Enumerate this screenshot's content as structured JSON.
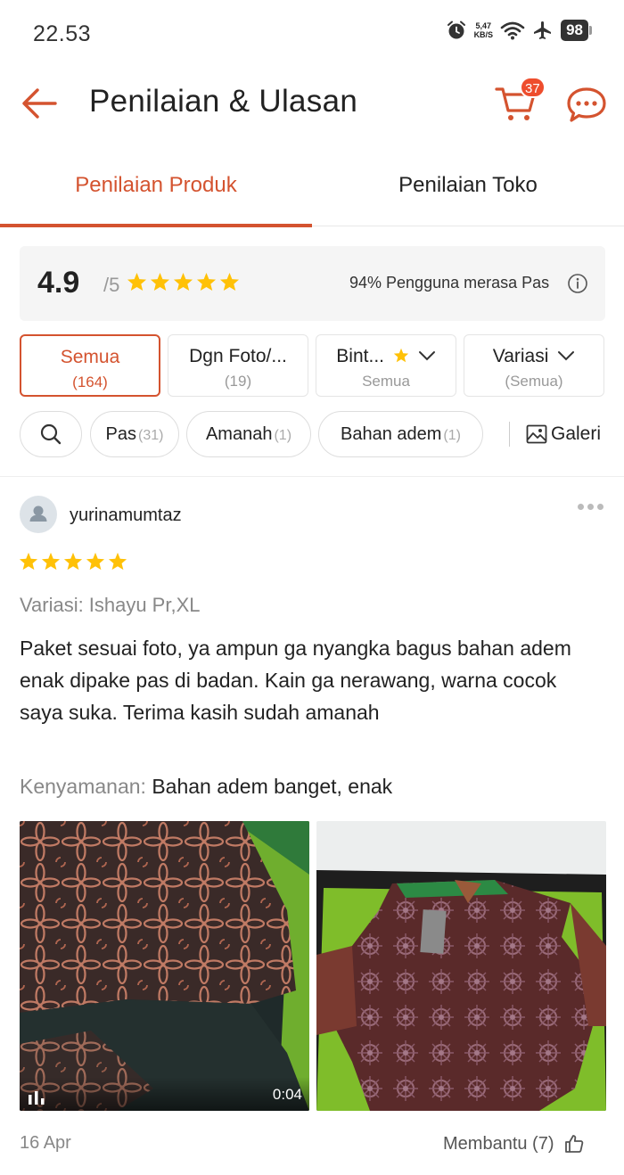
{
  "status_bar": {
    "time": "22.53",
    "speed_value": "5,47",
    "speed_unit": "KB/S",
    "battery": "98"
  },
  "header": {
    "title": "Penilaian & Ulasan",
    "cart_count": "37"
  },
  "tabs": [
    {
      "label": "Penilaian Produk",
      "active": true
    },
    {
      "label": "Penilaian Toko",
      "active": false
    }
  ],
  "summary": {
    "rating": "4.9",
    "max": "/5",
    "fit_text": "94% Pengguna merasa Pas"
  },
  "filters": [
    {
      "label": "Semua",
      "sub": "(164)"
    },
    {
      "label": "Dgn Foto/...",
      "sub": "(19)"
    },
    {
      "label": "Bint...",
      "sub": "Semua"
    },
    {
      "label": "Variasi",
      "sub": "(Semua)"
    }
  ],
  "chips": [
    {
      "label": "Pas",
      "count": "(31)"
    },
    {
      "label": "Amanah",
      "count": "(1)"
    },
    {
      "label": "Bahan adem",
      "count": "(1)"
    }
  ],
  "gallery_label": "Galeri",
  "review": {
    "username": "yurinamumtaz",
    "rating": 5,
    "variation_label": "Variasi:",
    "variation_value": "Ishayu Pr,XL",
    "text": "Paket sesuai foto, ya ampun ga nyangka bagus bahan adem enak dipake pas di badan. Kain ga nerawang, warna cocok saya suka. Terima kasih sudah amanah",
    "comfort_label": "Kenyamanan:",
    "comfort_value": "Bahan adem banget, enak",
    "video_duration": "0:04",
    "date": "16 Apr",
    "helpful": "Membantu (7)"
  },
  "colors": {
    "accent": "#d4532f",
    "star": "#ffc107",
    "badge": "#ee4d2d"
  }
}
